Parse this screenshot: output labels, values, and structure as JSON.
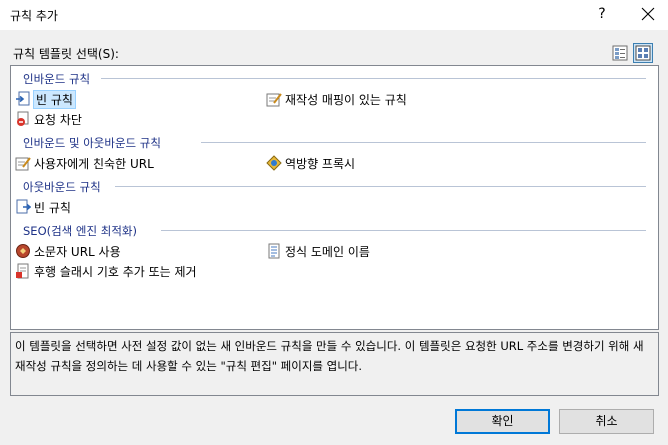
{
  "window": {
    "title": "규칙 추가",
    "help": "?"
  },
  "picker": {
    "label": "규칙 템플릿 선택(S):"
  },
  "groups": [
    {
      "header": "인바운드 규칙",
      "items": [
        "빈 규칙",
        "재작성 매핑이 있는 규칙",
        "요청 차단"
      ]
    },
    {
      "header": "인바운드 및 아웃바운드 규칙",
      "items": [
        "사용자에게 친숙한 URL",
        "역방향 프록시"
      ]
    },
    {
      "header": "아웃바운드 규칙",
      "items": [
        "빈 규칙"
      ]
    },
    {
      "header": "SEO(검색 엔진 최적화)",
      "items": [
        "소문자 URL 사용",
        "정식 도메인 이름",
        "후행 슬래시 기호 추가 또는 제거"
      ]
    }
  ],
  "description": "이 템플릿을 선택하면 사전 설정 값이 없는 새 인바운드 규칙을 만들 수 있습니다. 이 템플릿은 요청한 URL 주소를 변경하기 위해 새 재작성 규칙을 정의하는 데 사용할 수 있는 \"규칙 편집\" 페이지를 엽니다.",
  "buttons": {
    "ok": "확인",
    "cancel": "취소"
  },
  "colors": {
    "group_header": "#1e3287",
    "selection": "#cce8ff",
    "accent": "#0078d7"
  }
}
